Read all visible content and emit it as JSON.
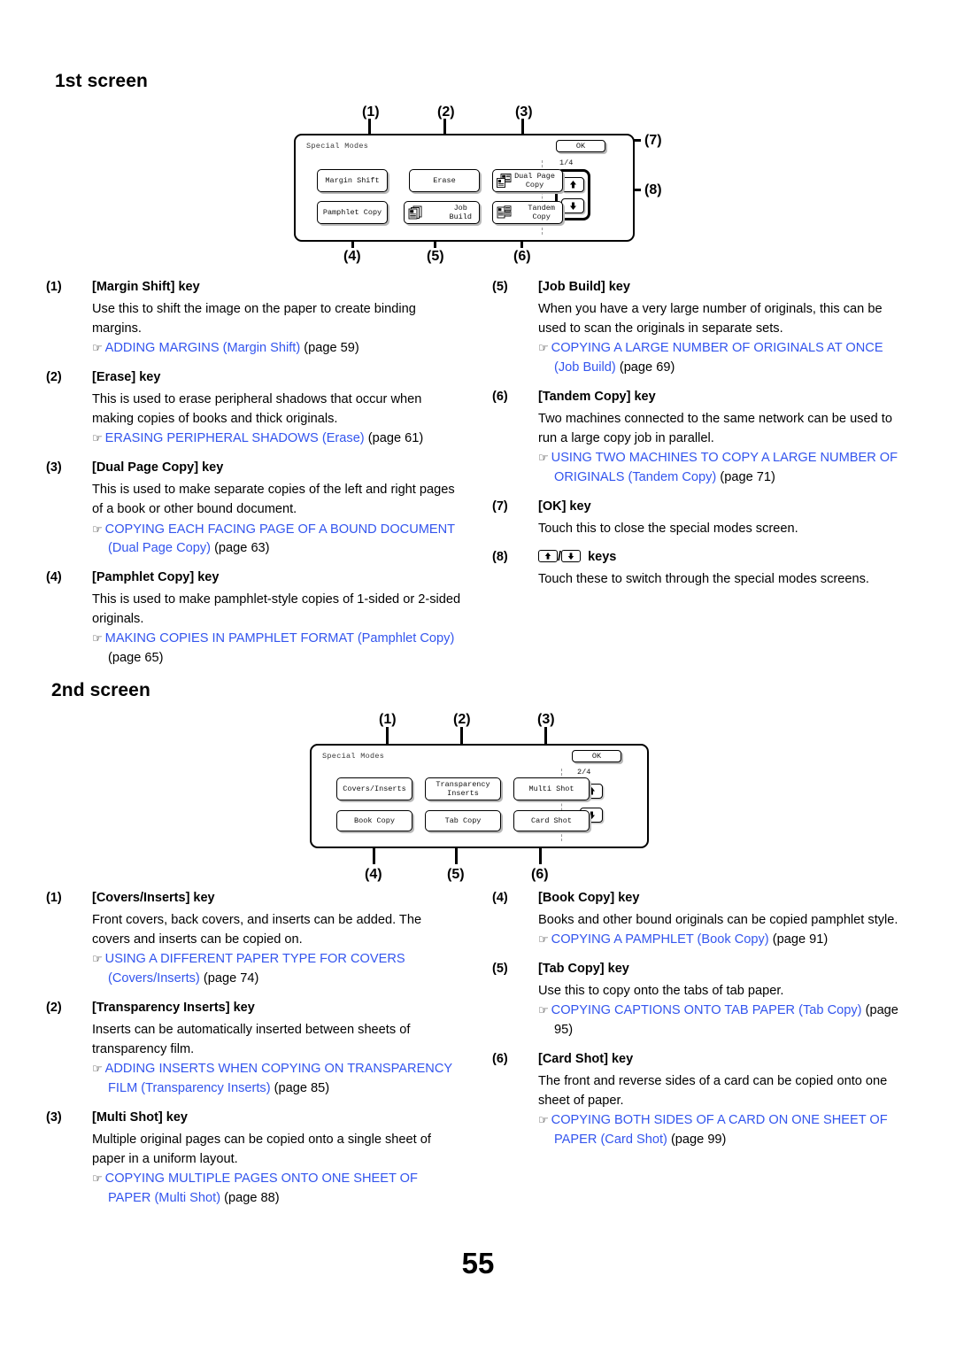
{
  "page_number": "55",
  "sections": [
    {
      "heading": "1st screen",
      "screen": {
        "title": "Special Modes",
        "ok_label": "OK",
        "page_indicator": "1/4",
        "keys": [
          {
            "label": "Margin Shift",
            "icon": "none"
          },
          {
            "label": "Erase",
            "icon": "none"
          },
          {
            "label": "Dual Page\nCopy",
            "line1": "Dual Page",
            "line2": "Copy",
            "icon": "dual-page-copy-icon"
          },
          {
            "label": "Pamphlet Copy",
            "icon": "none"
          },
          {
            "label": "Job\nBuild",
            "line1": "Job",
            "line2": "Build",
            "icon": "job-build-icon"
          },
          {
            "label": "Tandem\nCopy",
            "line1": "Tandem",
            "line2": "Copy",
            "icon": "tandem-copy-icon"
          }
        ],
        "callouts": [
          "(1)",
          "(2)",
          "(3)",
          "(4)",
          "(5)",
          "(6)",
          "(7)",
          "(8)"
        ]
      },
      "entries_left": [
        {
          "num": "(1)",
          "title": "[Margin Shift] key",
          "body": "Use this to shift the image on the paper to create binding margins.",
          "ref_link": "ADDING MARGINS (Margin Shift)",
          "ref_page": "(page 59)"
        },
        {
          "num": "(2)",
          "title": "[Erase] key",
          "body": "This is used to erase peripheral shadows that occur when making copies of books and thick originals.",
          "ref_link": "ERASING PERIPHERAL SHADOWS (Erase)",
          "ref_page": "(page 61)"
        },
        {
          "num": "(3)",
          "title": "[Dual Page Copy] key",
          "body": "This is used to make separate copies of the left and right pages of a book or other bound document.",
          "ref_link": "COPYING EACH FACING PAGE OF A BOUND DOCUMENT (Dual Page Copy)",
          "ref_page": "(page 63)"
        },
        {
          "num": "(4)",
          "title": "[Pamphlet Copy] key",
          "body": "This is used to make pamphlet-style copies of 1-sided or 2-sided originals.",
          "ref_link": "MAKING COPIES IN PAMPHLET FORMAT (Pamphlet Copy)",
          "ref_page": "(page 65)"
        }
      ],
      "entries_right": [
        {
          "num": "(5)",
          "title": "[Job Build] key",
          "body": "When you have a very large number of originals, this can be used to scan the originals in separate sets.",
          "ref_link": "COPYING A LARGE NUMBER OF ORIGINALS AT ONCE (Job Build)",
          "ref_page": "(page 69)"
        },
        {
          "num": "(6)",
          "title": "[Tandem Copy] key",
          "body": "Two machines connected to the same network can be used to run a large copy job in parallel.",
          "ref_link": "USING TWO MACHINES TO COPY A LARGE NUMBER OF ORIGINALS (Tandem Copy)",
          "ref_page": "(page 71)"
        },
        {
          "num": "(7)",
          "title": "[OK] key",
          "body": "Touch this to close the special modes screen.",
          "ref_link": "",
          "ref_page": ""
        },
        {
          "num": "(8)",
          "title_suffix": "keys",
          "title_icons": [
            "up-arrow-key-icon",
            "down-arrow-key-icon"
          ],
          "body": "Touch these to switch through the special modes screens.",
          "ref_link": "",
          "ref_page": ""
        }
      ]
    },
    {
      "heading": "2nd screen",
      "screen": {
        "title": "Special Modes",
        "ok_label": "OK",
        "page_indicator": "2/4",
        "keys": [
          {
            "label": "Covers/Inserts",
            "icon": "none"
          },
          {
            "label": "Transparency\nInserts",
            "line1": "Transparency",
            "line2": "Inserts",
            "icon": "none"
          },
          {
            "label": "Multi Shot",
            "icon": "none"
          },
          {
            "label": "Book Copy",
            "icon": "none"
          },
          {
            "label": "Tab Copy",
            "icon": "none"
          },
          {
            "label": "Card Shot",
            "icon": "none"
          }
        ],
        "callouts": [
          "(1)",
          "(2)",
          "(3)",
          "(4)",
          "(5)",
          "(6)"
        ]
      },
      "entries_left": [
        {
          "num": "(1)",
          "title": "[Covers/Inserts] key",
          "body": "Front covers, back covers, and inserts can be added. The covers and inserts can be copied on.",
          "ref_link": "USING A DIFFERENT PAPER TYPE FOR COVERS (Covers/Inserts)",
          "ref_page": "(page 74)"
        },
        {
          "num": "(2)",
          "title": "[Transparency Inserts] key",
          "body": "Inserts can be automatically inserted between sheets of transparency film.",
          "ref_link": "ADDING INSERTS WHEN COPYING ON TRANSPARENCY FILM (Transparency Inserts)",
          "ref_page": "(page 85)"
        },
        {
          "num": "(3)",
          "title": "[Multi Shot] key",
          "body": "Multiple original pages can be copied onto a single sheet of paper in a uniform layout.",
          "ref_link": "COPYING MULTIPLE PAGES ONTO ONE SHEET OF PAPER (Multi Shot)",
          "ref_page": "(page 88)"
        }
      ],
      "entries_right": [
        {
          "num": "(4)",
          "title": "[Book Copy] key",
          "body": "Books and other bound originals can be copied pamphlet style.",
          "ref_link": "COPYING A PAMPHLET (Book Copy)",
          "ref_page": "(page 91)"
        },
        {
          "num": "(5)",
          "title": "[Tab Copy] key",
          "body": "Use this to copy onto the tabs of tab paper.",
          "ref_link": "COPYING CAPTIONS ONTO TAB PAPER (Tab Copy)",
          "ref_page": "(page 95)"
        },
        {
          "num": "(6)",
          "title": "[Card Shot] key",
          "body": "The front and reverse sides of a card can be copied onto one sheet of paper.",
          "ref_link": "COPYING BOTH SIDES OF A CARD ON ONE SHEET OF PAPER (Card Shot)",
          "ref_page": "(page 99)"
        }
      ]
    }
  ],
  "colors": {
    "link": "#3355ee",
    "text": "#000000",
    "panel_border": "#000000"
  }
}
